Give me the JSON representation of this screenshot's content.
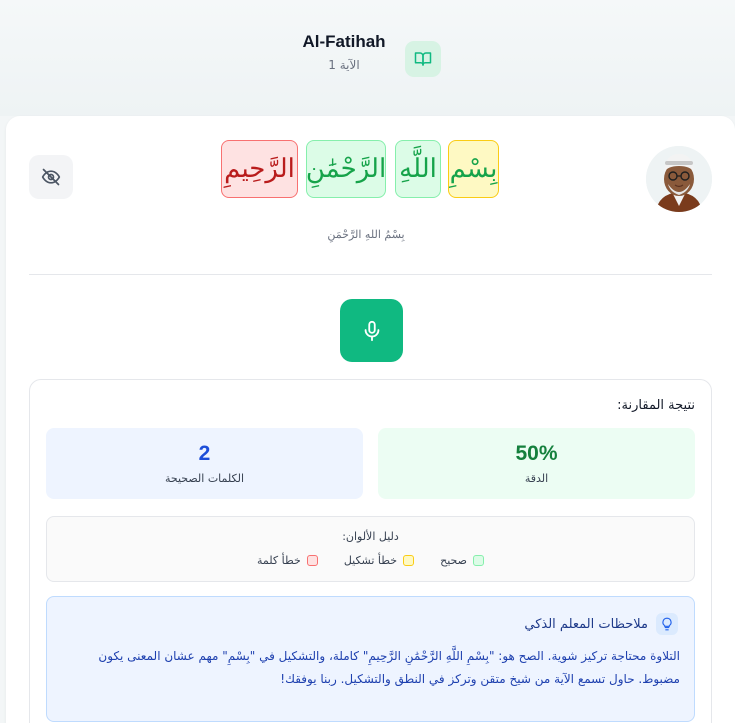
{
  "header": {
    "surah_name": "Al-Fatihah",
    "ayah_label": "الآية 1"
  },
  "ayah": {
    "words": [
      {
        "text": "بِسْمِ",
        "status": "diacritic-error"
      },
      {
        "text": "اللَّهِ",
        "status": "correct"
      },
      {
        "text": "الرَّحْمَٰنِ",
        "status": "correct"
      },
      {
        "text": "الرَّحِيمِ",
        "status": "word-error"
      }
    ],
    "transcription": "بِسْمُ اللهِ الرَّحْمَنِ"
  },
  "results": {
    "title": "نتيجة المقارنة:",
    "accuracy_value": "50%",
    "accuracy_label": "الدقة",
    "correct_words_value": "2",
    "correct_words_label": "الكلمات الصحيحة"
  },
  "legend": {
    "title": "دليل الألوان:",
    "correct": "صحيح",
    "diacritic_error": "خطأ تشكيل",
    "word_error": "خطأ كلمة"
  },
  "notes": {
    "title": "ملاحظات المعلم الذكي",
    "body": "التلاوة محتاجة تركيز شوية. الصح هو: \"بِسْمِ اللَّهِ الرَّحْمَٰنِ الرَّحِيمِ\" كاملة، والتشكيل في \"بِسْمِ\" مهم عشان المعنى يكون مضبوط. حاول تسمع الآية من شيخ متقن وتركز في النطق والتشكيل. ربنا يوفقك!"
  },
  "colors": {
    "accent": "#10b981",
    "correct": "#dcfce7",
    "diacritic_error": "#fef9c3",
    "word_error": "#fee2e2"
  },
  "icons": [
    "book-open-icon",
    "eye-off-icon",
    "microphone-icon",
    "lightbulb-icon"
  ]
}
